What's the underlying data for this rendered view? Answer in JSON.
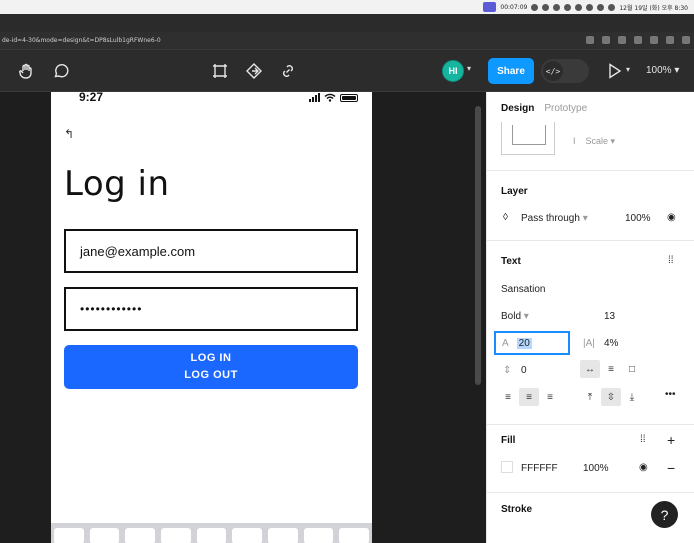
{
  "mac_menubar": {
    "recording_time": "00:07:09",
    "datetime": "12월 19일 (화) 오후 8:30"
  },
  "browser": {
    "url": "de-id=4-30&mode=design&t=DP8sLulb1gRFWne6-0"
  },
  "toolbar": {
    "avatar_initials": "HI",
    "share_label": "Share",
    "dev_mode_glyph": "</>",
    "zoom_label": "100%"
  },
  "phone": {
    "status_time": "9:27",
    "title": "Log in",
    "email_value": "jane@example.com",
    "password_value": "••••••••••••",
    "button_line1": "LOG IN",
    "button_line2": "LOG OUT"
  },
  "panel": {
    "tab_design": "Design",
    "tab_prototype": "Prototype",
    "scale_label": "Scale",
    "layer_title": "Layer",
    "blend_mode": "Pass through",
    "layer_opacity": "100%",
    "text_title": "Text",
    "font_family": "Sansation",
    "font_weight": "Bold",
    "font_size": "13",
    "line_height": "20",
    "letter_spacing": "4%",
    "paragraph_spacing": "0",
    "fill_title": "Fill",
    "fill_hex": "FFFFFF",
    "fill_opacity": "100%",
    "stroke_title": "Stroke"
  },
  "help_label": "?"
}
